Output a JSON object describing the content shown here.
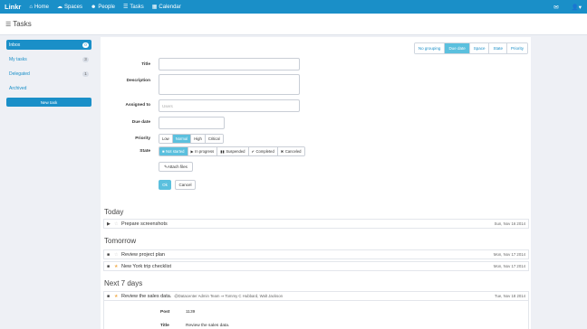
{
  "topbar": {
    "brand": "Linkr",
    "nav": [
      {
        "icon": "home-icon",
        "glyph": "⌂",
        "label": "Home"
      },
      {
        "icon": "spaces-icon",
        "glyph": "☁",
        "label": "Spaces"
      },
      {
        "icon": "people-icon",
        "glyph": "☻",
        "label": "People"
      },
      {
        "icon": "tasks-icon",
        "glyph": "☰",
        "label": "Tasks"
      },
      {
        "icon": "calendar-icon",
        "glyph": "▦",
        "label": "Calendar"
      }
    ],
    "mail_glyph": "✉",
    "user_glyph": "👤▾"
  },
  "header": {
    "icon_glyph": "☰",
    "title": "Tasks"
  },
  "sidebar": {
    "items": [
      {
        "label": "Inbox",
        "count": "0",
        "active": true
      },
      {
        "label": "My tasks",
        "count": "3",
        "active": false
      },
      {
        "label": "Delegated",
        "count": "1",
        "active": false
      },
      {
        "label": "Archived",
        "count": "",
        "active": false
      }
    ],
    "new_task": "New task"
  },
  "grouping": {
    "options": [
      "No grouping",
      "Due date",
      "Space",
      "State",
      "Priority"
    ],
    "active": "Due date"
  },
  "form": {
    "title_label": "Title",
    "description_label": "Description",
    "assigned_label": "Assigned to",
    "assigned_placeholder": "Users",
    "due_label": "Due date",
    "priority_label": "Priority",
    "priority_options": [
      "Low",
      "Normal",
      "High",
      "Critical"
    ],
    "priority_selected": "Normal",
    "state_label": "State",
    "state_options": [
      {
        "glyph": "■",
        "label": "Not started"
      },
      {
        "glyph": "▶",
        "label": "In progress"
      },
      {
        "glyph": "▮▮",
        "label": "Suspended"
      },
      {
        "glyph": "✔",
        "label": "Completed"
      },
      {
        "glyph": "✖",
        "label": "Canceled"
      }
    ],
    "state_selected": "Not started",
    "attach": "✎Attach files",
    "ok": "Ok",
    "cancel": "Cancel"
  },
  "sections": [
    {
      "title": "Today",
      "tasks": [
        {
          "handle": "▶",
          "starred": false,
          "name": "Prepare screenshots",
          "meta": "",
          "date": "Sun, Nov 16 2014"
        }
      ]
    },
    {
      "title": "Tomorrow",
      "tasks": [
        {
          "handle": "■",
          "starred": false,
          "name": "Review project plan",
          "meta": "",
          "date": "Mon, Nov 17 2014"
        },
        {
          "handle": "■",
          "starred": true,
          "name": "New York trip checklist",
          "meta": "",
          "date": "Mon, Nov 17 2014"
        }
      ]
    },
    {
      "title": "Next 7 days",
      "tasks": [
        {
          "handle": "■",
          "starred": true,
          "name": "Review the sales data.",
          "meta": "@Datacenter Admin Team ⇒ Tommy C Hubbard, Walt Jackson",
          "date": "Tue, Nov 18 2014"
        }
      ]
    }
  ],
  "detail": {
    "post_label": "Post",
    "post_value": "1139",
    "title_label": "Title",
    "title_value": "Review the sales data."
  },
  "colors": {
    "primary": "#1a8fc8",
    "accent": "#5bc0de",
    "star": "#f0ad4e"
  }
}
